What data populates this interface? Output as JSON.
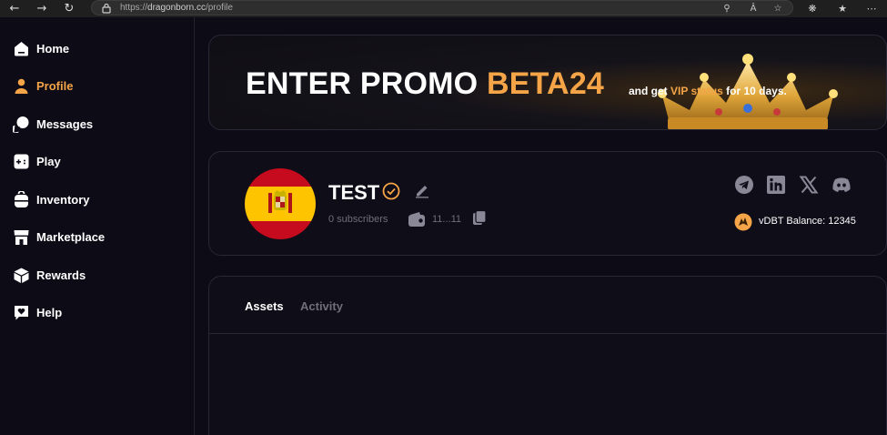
{
  "browser": {
    "url_prefix": "https://",
    "url_host": "dragonborn.cc",
    "url_path": "/profile"
  },
  "sidebar": {
    "items": [
      {
        "label": "Home",
        "icon": "home-icon",
        "active": false
      },
      {
        "label": "Profile",
        "icon": "person-icon",
        "active": true
      },
      {
        "label": "Messages",
        "icon": "chat-icon",
        "active": false
      },
      {
        "label": "Play",
        "icon": "gamepad-icon",
        "active": false
      },
      {
        "label": "Inventory",
        "icon": "backpack-icon",
        "active": false
      },
      {
        "label": "Marketplace",
        "icon": "store-icon",
        "active": false
      },
      {
        "label": "Rewards",
        "icon": "box-icon",
        "active": false
      },
      {
        "label": "Help",
        "icon": "heart-chat-icon",
        "active": false
      }
    ]
  },
  "banner": {
    "title_prefix": "ENTER PROMO ",
    "promo_code": "BETA24",
    "sub_prefix": "and get ",
    "sub_highlight": "VIP status",
    "sub_suffix": " for 10 days."
  },
  "profile": {
    "name": "TEST",
    "subscribers": "0 subscribers",
    "wallet": "11...11",
    "balance_label": "vDBT Balance: 12345",
    "avatar_icon": "spain-flag"
  },
  "tabs": {
    "assets": "Assets",
    "activity": "Activity"
  },
  "colors": {
    "accent": "#f5a547",
    "background": "#0c0b16",
    "card": "#0e0d18",
    "muted": "#6f6e7b"
  }
}
